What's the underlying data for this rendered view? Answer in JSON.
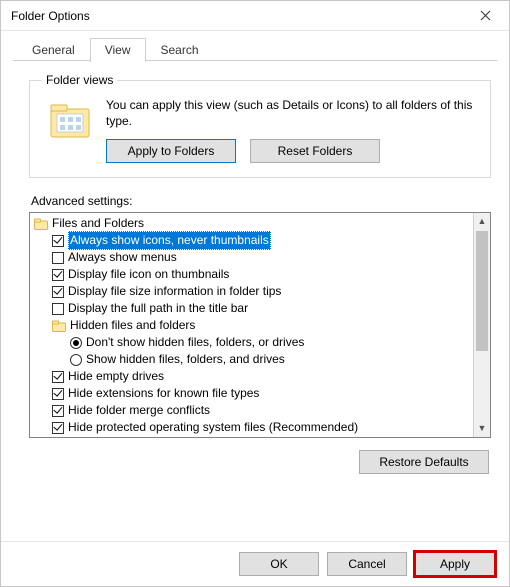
{
  "window": {
    "title": "Folder Options"
  },
  "tabs": {
    "general": "General",
    "view": "View",
    "search": "Search",
    "active": "view"
  },
  "folder_views": {
    "legend": "Folder views",
    "text": "You can apply this view (such as Details or Icons) to all folders of this type.",
    "apply_btn": "Apply to Folders",
    "reset_btn": "Reset Folders"
  },
  "advanced": {
    "label": "Advanced settings:"
  },
  "tree": {
    "group": "Files and Folders",
    "items": [
      {
        "kind": "check",
        "checked": true,
        "label": "Always show icons, never thumbnails",
        "selected": true
      },
      {
        "kind": "check",
        "checked": false,
        "label": "Always show menus"
      },
      {
        "kind": "check",
        "checked": true,
        "label": "Display file icon on thumbnails"
      },
      {
        "kind": "check",
        "checked": true,
        "label": "Display file size information in folder tips"
      },
      {
        "kind": "check",
        "checked": false,
        "label": "Display the full path in the title bar"
      },
      {
        "kind": "folder",
        "label": "Hidden files and folders"
      },
      {
        "kind": "radio",
        "checked": true,
        "label": "Don't show hidden files, folders, or drives",
        "indent": 2
      },
      {
        "kind": "radio",
        "checked": false,
        "label": "Show hidden files, folders, and drives",
        "indent": 2
      },
      {
        "kind": "check",
        "checked": true,
        "label": "Hide empty drives"
      },
      {
        "kind": "check",
        "checked": true,
        "label": "Hide extensions for known file types"
      },
      {
        "kind": "check",
        "checked": true,
        "label": "Hide folder merge conflicts"
      },
      {
        "kind": "check",
        "checked": true,
        "label": "Hide protected operating system files (Recommended)"
      }
    ]
  },
  "restore_btn": "Restore Defaults",
  "footer": {
    "ok": "OK",
    "cancel": "Cancel",
    "apply": "Apply"
  }
}
